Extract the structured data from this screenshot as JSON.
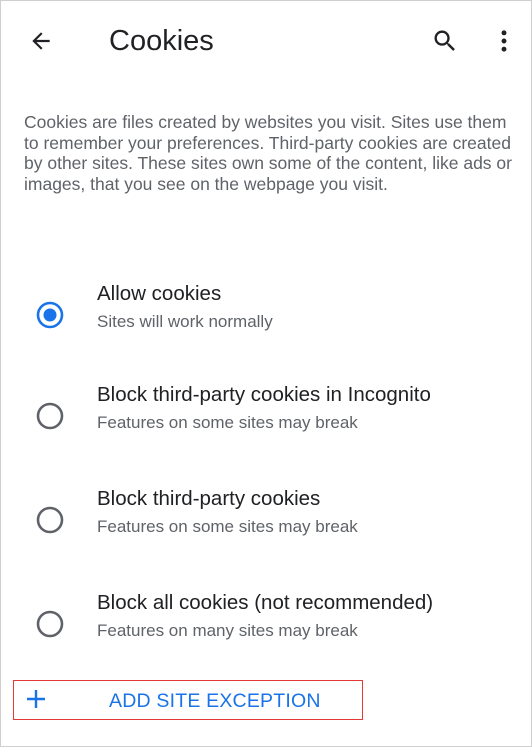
{
  "header": {
    "title": "Cookies"
  },
  "description": "Cookies are files created by websites you visit. Sites use them to remember your preferences. Third-party cookies are created by other sites. These sites own some of the content, like ads or images, that you see on the webpage you visit.",
  "options": [
    {
      "title": "Allow cookies",
      "subtitle": "Sites will work normally",
      "selected": true
    },
    {
      "title": "Block third-party cookies in Incognito",
      "subtitle": "Features on some sites may break",
      "selected": false
    },
    {
      "title": "Block third-party cookies",
      "subtitle": "Features on some sites may break",
      "selected": false
    },
    {
      "title": "Block all cookies (not recommended)",
      "subtitle": "Features on many sites may break",
      "selected": false
    }
  ],
  "add_exception": {
    "label": "ADD SITE EXCEPTION"
  },
  "icons": {
    "back": "arrow-back-icon",
    "search": "search-icon",
    "more": "more-vert-icon",
    "add": "plus-icon"
  },
  "colors": {
    "accent": "#1a73e8",
    "text_primary": "#202124",
    "text_secondary": "#5f6368",
    "radio_unselected": "#5f6368",
    "highlight_border": "#e53935"
  }
}
